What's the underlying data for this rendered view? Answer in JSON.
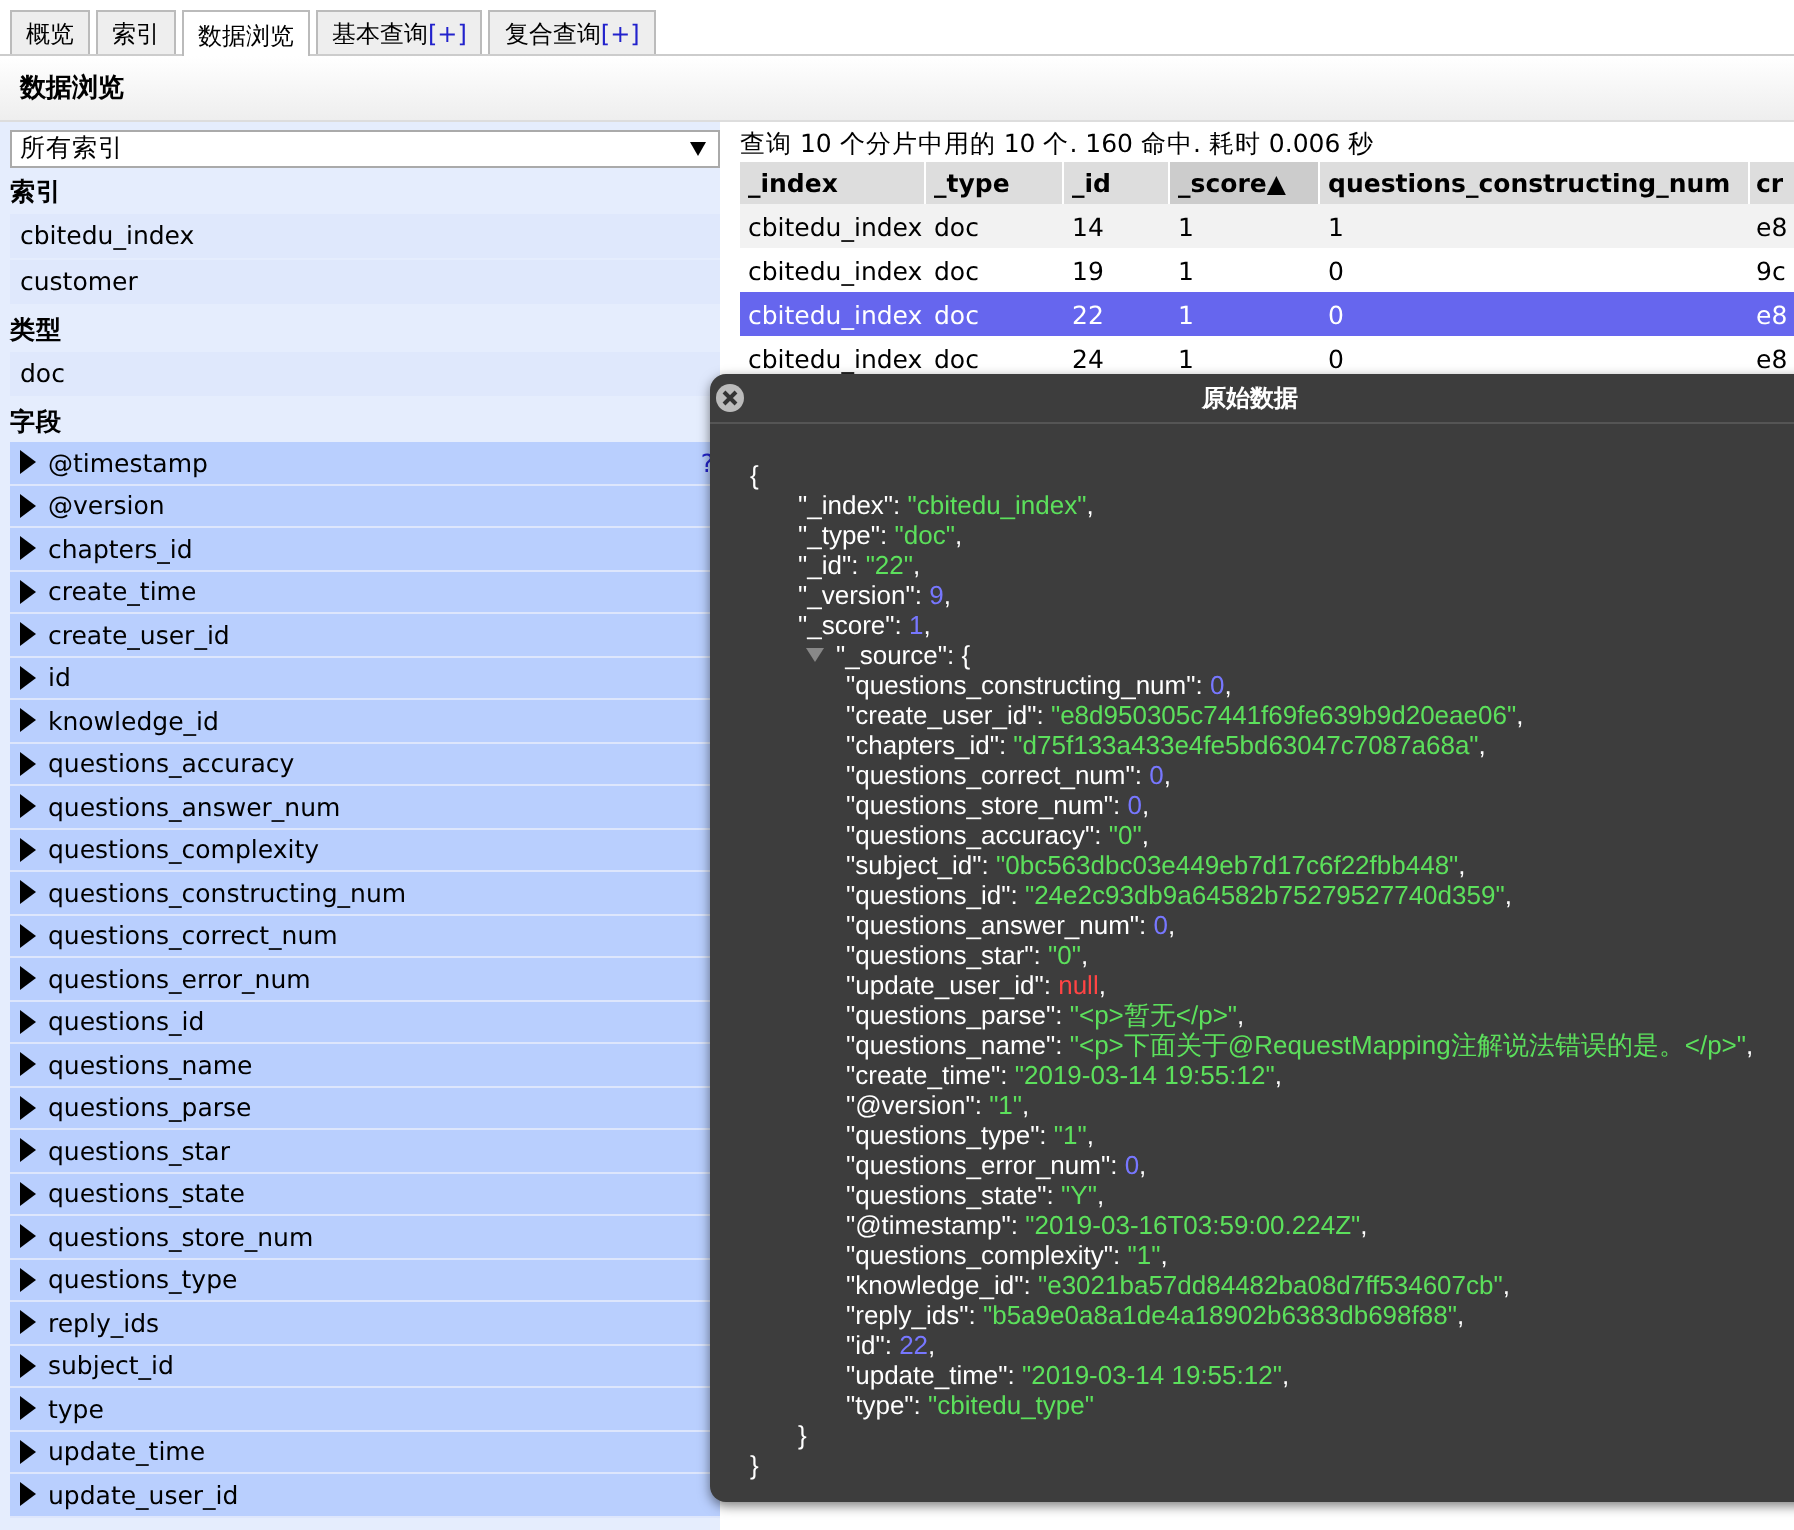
{
  "tabs": [
    {
      "label": "概览",
      "selected": false
    },
    {
      "label": "索引",
      "selected": false
    },
    {
      "label": "数据浏览",
      "selected": true
    },
    {
      "label": "基本查询",
      "extra": "[+]",
      "selected": false
    },
    {
      "label": "复合查询",
      "extra": "[+]",
      "selected": false
    }
  ],
  "page_title": "数据浏览",
  "sidebar": {
    "index_select": "所有索引",
    "sections": [
      {
        "heading": "索引",
        "kind": "plain",
        "items": [
          {
            "label": "cbitedu_index"
          },
          {
            "label": "customer"
          }
        ]
      },
      {
        "heading": "类型",
        "kind": "plain",
        "items": [
          {
            "label": "doc"
          }
        ]
      },
      {
        "heading": "字段",
        "kind": "field",
        "help": "?",
        "items": [
          {
            "label": "@timestamp"
          },
          {
            "label": "@version"
          },
          {
            "label": "chapters_id"
          },
          {
            "label": "create_time"
          },
          {
            "label": "create_user_id"
          },
          {
            "label": "id"
          },
          {
            "label": "knowledge_id"
          },
          {
            "label": "questions_accuracy"
          },
          {
            "label": "questions_answer_num"
          },
          {
            "label": "questions_complexity"
          },
          {
            "label": "questions_constructing_num"
          },
          {
            "label": "questions_correct_num"
          },
          {
            "label": "questions_error_num"
          },
          {
            "label": "questions_id"
          },
          {
            "label": "questions_name"
          },
          {
            "label": "questions_parse"
          },
          {
            "label": "questions_star"
          },
          {
            "label": "questions_state"
          },
          {
            "label": "questions_store_num"
          },
          {
            "label": "questions_type"
          },
          {
            "label": "reply_ids"
          },
          {
            "label": "subject_id"
          },
          {
            "label": "type"
          },
          {
            "label": "update_time"
          },
          {
            "label": "update_user_id"
          }
        ]
      }
    ]
  },
  "results": {
    "summary": "查询 10 个分片中用的 10 个. 160 命中. 耗时 0.006 秒",
    "table": {
      "columns": [
        {
          "label": "_index",
          "sorted": false
        },
        {
          "label": "_type",
          "sorted": false
        },
        {
          "label": "_id",
          "sorted": false
        },
        {
          "label": "_score",
          "sorted": true,
          "sort_mark": "▲"
        },
        {
          "label": "questions_constructing_num",
          "sorted": false
        },
        {
          "label": "cr",
          "sorted": false
        }
      ],
      "rows": [
        {
          "cells": [
            "cbitedu_index",
            "doc",
            "14",
            "1",
            "1",
            "e8"
          ],
          "selected": false
        },
        {
          "cells": [
            "cbitedu_index",
            "doc",
            "19",
            "1",
            "0",
            "9c"
          ],
          "selected": false
        },
        {
          "cells": [
            "cbitedu_index",
            "doc",
            "22",
            "1",
            "0",
            "e8"
          ],
          "selected": true
        },
        {
          "cells": [
            "cbitedu_index",
            "doc",
            "24",
            "1",
            "0",
            "e8"
          ],
          "selected": false
        }
      ]
    }
  },
  "dialog": {
    "title": "原始数据",
    "open": "{",
    "close": "}",
    "lines": [
      {
        "key": "\"_index\"",
        "sep": ": ",
        "value": "\"cbitedu_index\"",
        "kind": "str",
        "end": ","
      },
      {
        "key": "\"_type\"",
        "sep": ": ",
        "value": "\"doc\"",
        "kind": "str",
        "end": ","
      },
      {
        "key": "\"_id\"",
        "sep": ": ",
        "value": "\"22\"",
        "kind": "str",
        "end": ","
      },
      {
        "key": "\"_version\"",
        "sep": ": ",
        "value": "9",
        "kind": "num",
        "end": ","
      },
      {
        "key": "\"_score\"",
        "sep": ": ",
        "value": "1",
        "kind": "num",
        "end": ","
      },
      {
        "key": "\"_source\"",
        "sep": ": {",
        "kind": "obj",
        "expanded": true,
        "close": "}",
        "children": [
          {
            "key": "\"questions_constructing_num\"",
            "sep": ": ",
            "value": "0",
            "kind": "num",
            "end": ","
          },
          {
            "key": "\"create_user_id\"",
            "sep": ": ",
            "value": "\"e8d950305c7441f69fe639b9d20eae06\"",
            "kind": "str",
            "end": ","
          },
          {
            "key": "\"chapters_id\"",
            "sep": ": ",
            "value": "\"d75f133a433e4fe5bd63047c7087a68a\"",
            "kind": "str",
            "end": ","
          },
          {
            "key": "\"questions_correct_num\"",
            "sep": ": ",
            "value": "0",
            "kind": "num",
            "end": ","
          },
          {
            "key": "\"questions_store_num\"",
            "sep": ": ",
            "value": "0",
            "kind": "num",
            "end": ","
          },
          {
            "key": "\"questions_accuracy\"",
            "sep": ": ",
            "value": "\"0\"",
            "kind": "str",
            "end": ","
          },
          {
            "key": "\"subject_id\"",
            "sep": ": ",
            "value": "\"0bc563dbc03e449eb7d17c6f22fbb448\"",
            "kind": "str",
            "end": ","
          },
          {
            "key": "\"questions_id\"",
            "sep": ": ",
            "value": "\"24e2c93db9a64582b75279527740d359\"",
            "kind": "str",
            "end": ","
          },
          {
            "key": "\"questions_answer_num\"",
            "sep": ": ",
            "value": "0",
            "kind": "num",
            "end": ","
          },
          {
            "key": "\"questions_star\"",
            "sep": ": ",
            "value": "\"0\"",
            "kind": "str",
            "end": ","
          },
          {
            "key": "\"update_user_id\"",
            "sep": ": ",
            "value": "null",
            "kind": "null",
            "end": ","
          },
          {
            "key": "\"questions_parse\"",
            "sep": ": ",
            "value": "\"<p>暂无</p>\"",
            "kind": "str",
            "end": ","
          },
          {
            "key": "\"questions_name\"",
            "sep": ": ",
            "value": "\"<p>下面关于@RequestMapping注解说法错误的是。</p>\"",
            "kind": "str",
            "end": ","
          },
          {
            "key": "\"create_time\"",
            "sep": ": ",
            "value": "\"2019-03-14 19:55:12\"",
            "kind": "str",
            "end": ","
          },
          {
            "key": "\"@version\"",
            "sep": ": ",
            "value": "\"1\"",
            "kind": "str",
            "end": ","
          },
          {
            "key": "\"questions_type\"",
            "sep": ": ",
            "value": "\"1\"",
            "kind": "str",
            "end": ","
          },
          {
            "key": "\"questions_error_num\"",
            "sep": ": ",
            "value": "0",
            "kind": "num",
            "end": ","
          },
          {
            "key": "\"questions_state\"",
            "sep": ": ",
            "value": "\"Y\"",
            "kind": "str",
            "end": ","
          },
          {
            "key": "\"@timestamp\"",
            "sep": ": ",
            "value": "\"2019-03-16T03:59:00.224Z\"",
            "kind": "str",
            "end": ","
          },
          {
            "key": "\"questions_complexity\"",
            "sep": ": ",
            "value": "\"1\"",
            "kind": "str",
            "end": ","
          },
          {
            "key": "\"knowledge_id\"",
            "sep": ": ",
            "value": "\"e3021ba57dd84482ba08d7ff534607cb\"",
            "kind": "str",
            "end": ","
          },
          {
            "key": "\"reply_ids\"",
            "sep": ": ",
            "value": "\"b5a9e0a8a1de4a18902b6383db698f88\"",
            "kind": "str",
            "end": ","
          },
          {
            "key": "\"id\"",
            "sep": ": ",
            "value": "22",
            "kind": "num",
            "end": ","
          },
          {
            "key": "\"update_time\"",
            "sep": ": ",
            "value": "\"2019-03-14 19:55:12\"",
            "kind": "str",
            "end": ","
          },
          {
            "key": "\"type\"",
            "sep": ": ",
            "value": "\"cbitedu_type\"",
            "kind": "str"
          }
        ]
      }
    ]
  }
}
